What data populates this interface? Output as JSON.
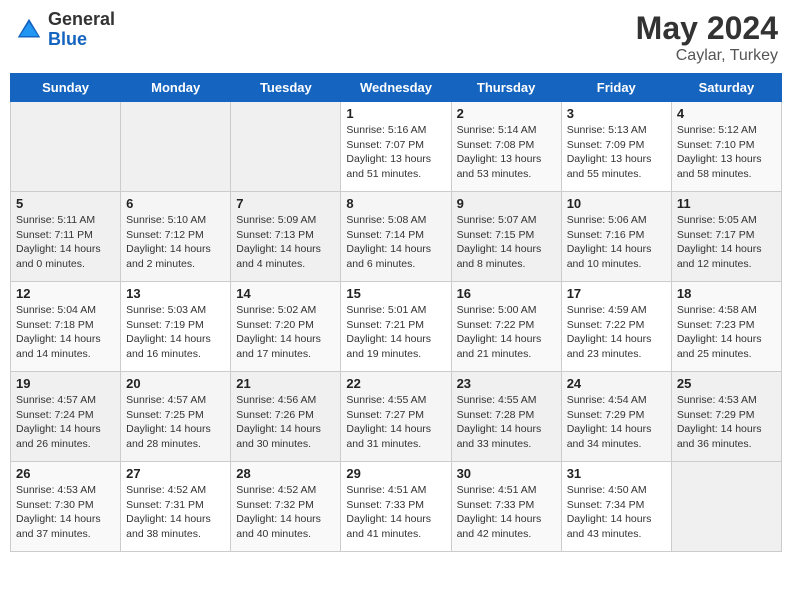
{
  "header": {
    "logo_general": "General",
    "logo_blue": "Blue",
    "month_year": "May 2024",
    "location": "Caylar, Turkey"
  },
  "days_of_week": [
    "Sunday",
    "Monday",
    "Tuesday",
    "Wednesday",
    "Thursday",
    "Friday",
    "Saturday"
  ],
  "weeks": [
    [
      {
        "day": "",
        "empty": true
      },
      {
        "day": "",
        "empty": true
      },
      {
        "day": "",
        "empty": true
      },
      {
        "day": "1",
        "sunrise": "5:16 AM",
        "sunset": "7:07 PM",
        "daylight": "13 hours and 51 minutes."
      },
      {
        "day": "2",
        "sunrise": "5:14 AM",
        "sunset": "7:08 PM",
        "daylight": "13 hours and 53 minutes."
      },
      {
        "day": "3",
        "sunrise": "5:13 AM",
        "sunset": "7:09 PM",
        "daylight": "13 hours and 55 minutes."
      },
      {
        "day": "4",
        "sunrise": "5:12 AM",
        "sunset": "7:10 PM",
        "daylight": "13 hours and 58 minutes."
      }
    ],
    [
      {
        "day": "5",
        "sunrise": "5:11 AM",
        "sunset": "7:11 PM",
        "daylight": "14 hours and 0 minutes."
      },
      {
        "day": "6",
        "sunrise": "5:10 AM",
        "sunset": "7:12 PM",
        "daylight": "14 hours and 2 minutes."
      },
      {
        "day": "7",
        "sunrise": "5:09 AM",
        "sunset": "7:13 PM",
        "daylight": "14 hours and 4 minutes."
      },
      {
        "day": "8",
        "sunrise": "5:08 AM",
        "sunset": "7:14 PM",
        "daylight": "14 hours and 6 minutes."
      },
      {
        "day": "9",
        "sunrise": "5:07 AM",
        "sunset": "7:15 PM",
        "daylight": "14 hours and 8 minutes."
      },
      {
        "day": "10",
        "sunrise": "5:06 AM",
        "sunset": "7:16 PM",
        "daylight": "14 hours and 10 minutes."
      },
      {
        "day": "11",
        "sunrise": "5:05 AM",
        "sunset": "7:17 PM",
        "daylight": "14 hours and 12 minutes."
      }
    ],
    [
      {
        "day": "12",
        "sunrise": "5:04 AM",
        "sunset": "7:18 PM",
        "daylight": "14 hours and 14 minutes."
      },
      {
        "day": "13",
        "sunrise": "5:03 AM",
        "sunset": "7:19 PM",
        "daylight": "14 hours and 16 minutes."
      },
      {
        "day": "14",
        "sunrise": "5:02 AM",
        "sunset": "7:20 PM",
        "daylight": "14 hours and 17 minutes."
      },
      {
        "day": "15",
        "sunrise": "5:01 AM",
        "sunset": "7:21 PM",
        "daylight": "14 hours and 19 minutes."
      },
      {
        "day": "16",
        "sunrise": "5:00 AM",
        "sunset": "7:22 PM",
        "daylight": "14 hours and 21 minutes."
      },
      {
        "day": "17",
        "sunrise": "4:59 AM",
        "sunset": "7:22 PM",
        "daylight": "14 hours and 23 minutes."
      },
      {
        "day": "18",
        "sunrise": "4:58 AM",
        "sunset": "7:23 PM",
        "daylight": "14 hours and 25 minutes."
      }
    ],
    [
      {
        "day": "19",
        "sunrise": "4:57 AM",
        "sunset": "7:24 PM",
        "daylight": "14 hours and 26 minutes."
      },
      {
        "day": "20",
        "sunrise": "4:57 AM",
        "sunset": "7:25 PM",
        "daylight": "14 hours and 28 minutes."
      },
      {
        "day": "21",
        "sunrise": "4:56 AM",
        "sunset": "7:26 PM",
        "daylight": "14 hours and 30 minutes."
      },
      {
        "day": "22",
        "sunrise": "4:55 AM",
        "sunset": "7:27 PM",
        "daylight": "14 hours and 31 minutes."
      },
      {
        "day": "23",
        "sunrise": "4:55 AM",
        "sunset": "7:28 PM",
        "daylight": "14 hours and 33 minutes."
      },
      {
        "day": "24",
        "sunrise": "4:54 AM",
        "sunset": "7:29 PM",
        "daylight": "14 hours and 34 minutes."
      },
      {
        "day": "25",
        "sunrise": "4:53 AM",
        "sunset": "7:29 PM",
        "daylight": "14 hours and 36 minutes."
      }
    ],
    [
      {
        "day": "26",
        "sunrise": "4:53 AM",
        "sunset": "7:30 PM",
        "daylight": "14 hours and 37 minutes."
      },
      {
        "day": "27",
        "sunrise": "4:52 AM",
        "sunset": "7:31 PM",
        "daylight": "14 hours and 38 minutes."
      },
      {
        "day": "28",
        "sunrise": "4:52 AM",
        "sunset": "7:32 PM",
        "daylight": "14 hours and 40 minutes."
      },
      {
        "day": "29",
        "sunrise": "4:51 AM",
        "sunset": "7:33 PM",
        "daylight": "14 hours and 41 minutes."
      },
      {
        "day": "30",
        "sunrise": "4:51 AM",
        "sunset": "7:33 PM",
        "daylight": "14 hours and 42 minutes."
      },
      {
        "day": "31",
        "sunrise": "4:50 AM",
        "sunset": "7:34 PM",
        "daylight": "14 hours and 43 minutes."
      },
      {
        "day": "",
        "empty": true
      }
    ]
  ]
}
